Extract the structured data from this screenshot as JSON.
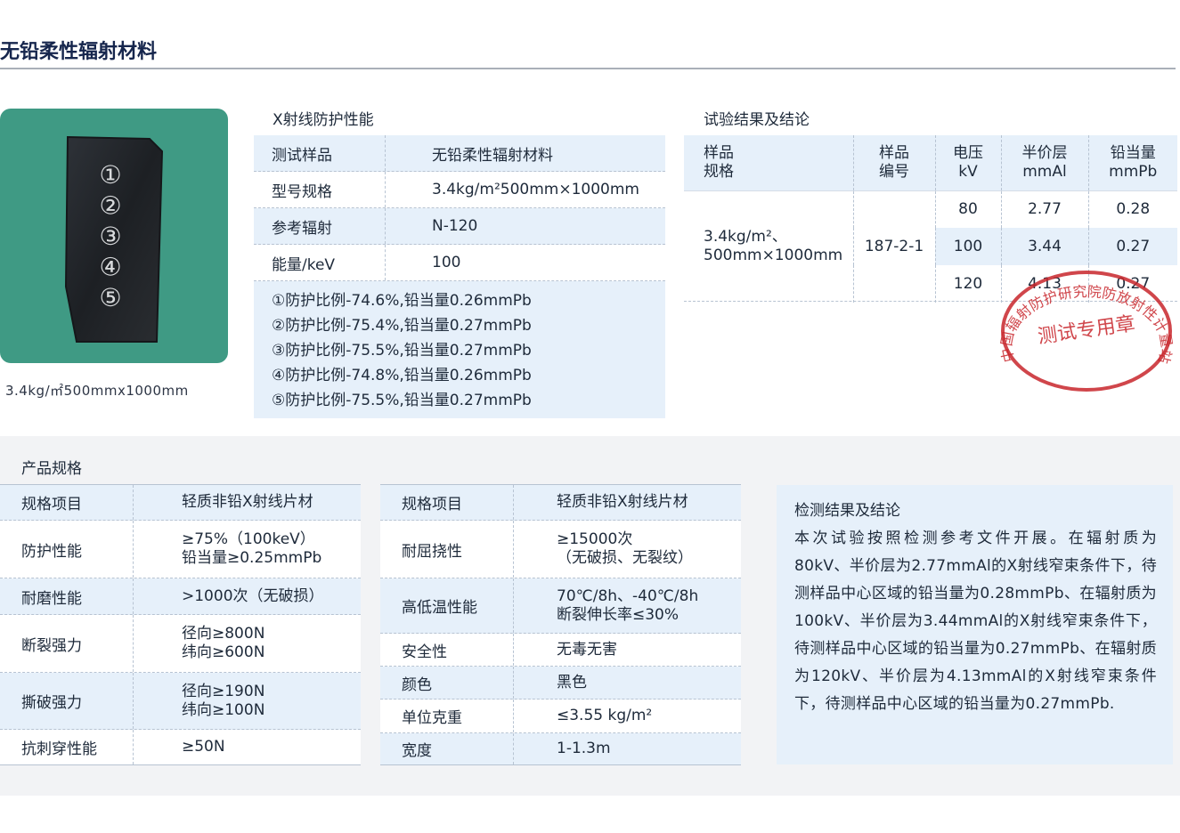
{
  "page_title": "无铅柔性辐射材料",
  "sample": {
    "caption": "3.4kg/㎡500mmx1000mm",
    "markers": [
      "①",
      "②",
      "③",
      "④",
      "⑤"
    ]
  },
  "xray": {
    "heading": "X射线防护性能",
    "rows": [
      {
        "label": "测试样品",
        "value": "无铅柔性辐射材料"
      },
      {
        "label": "型号规格",
        "value": "3.4kg/m²500mm×1000mm"
      },
      {
        "label": "参考辐射",
        "value": "N-120"
      },
      {
        "label": "能量/keV",
        "value": "100"
      }
    ],
    "results": [
      "①防护比例-74.6%,铅当量0.26mmPb",
      "②防护比例-75.4%,铅当量0.27mmPb",
      "③防护比例-75.5%,铅当量0.27mmPb",
      "④防护比例-74.8%,铅当量0.26mmPb",
      "⑤防护比例-75.5%,铅当量0.27mmPb"
    ]
  },
  "test": {
    "heading": "试验结果及结论",
    "headers": [
      {
        "l1": "样品",
        "l2": "规格"
      },
      {
        "l1": "样品",
        "l2": "编号"
      },
      {
        "l1": "电压",
        "l2": "kV"
      },
      {
        "l1": "半价层",
        "l2": "mmAl"
      },
      {
        "l1": "铅当量",
        "l2": "mmPb"
      }
    ],
    "spec_l1": "3.4kg/m²、",
    "spec_l2": "500mm×1000mm",
    "sample_no": "187-2-1",
    "rows": [
      {
        "kv": "80",
        "hvl": "2.77",
        "pb": "0.28"
      },
      {
        "kv": "100",
        "hvl": "3.44",
        "pb": "0.27"
      },
      {
        "kv": "120",
        "hvl": "4.13",
        "pb": "0.27"
      }
    ]
  },
  "stamp": {
    "ring_text": "中国辐射防护研究院防放射性计量站",
    "center_text": "测试专用章",
    "color": "#c8262c"
  },
  "spec": {
    "heading": "产品规格",
    "left": {
      "head": {
        "k": "规格项目",
        "v": [
          "轻质非铅X射线片材"
        ]
      },
      "rows": [
        {
          "k": "防护性能",
          "v": [
            "≥75%（100keV）",
            "铅当量≥0.25mmPb"
          ]
        },
        {
          "k": "耐磨性能",
          "v": [
            ">1000次（无破损）"
          ]
        },
        {
          "k": "断裂强力",
          "v": [
            "径向≥800N",
            "纬向≥600N"
          ]
        },
        {
          "k": "撕破强力",
          "v": [
            "径向≥190N",
            "纬向≥100N"
          ]
        },
        {
          "k": "抗刺穿性能",
          "v": [
            "≥50N"
          ]
        }
      ]
    },
    "right": {
      "head": {
        "k": "规格项目",
        "v": [
          "轻质非铅X射线片材"
        ]
      },
      "rows": [
        {
          "k": "耐屈挠性",
          "v": [
            "≥15000次",
            "（无破损、无裂纹）"
          ]
        },
        {
          "k": "高低温性能",
          "v": [
            "70℃/8h、-40℃/8h",
            "断裂伸长率≤30%"
          ]
        },
        {
          "k": "安全性",
          "v": [
            "无毒无害"
          ]
        },
        {
          "k": "颜色",
          "v": [
            "黑色"
          ]
        },
        {
          "k": "单位克重",
          "v": [
            "≤3.55 kg/m²"
          ]
        },
        {
          "k": "宽度",
          "v": [
            "1-1.3m"
          ]
        }
      ]
    }
  },
  "conclusion": {
    "title": "检测结果及结论",
    "body": "本次试验按照检测参考文件开展。在辐射质为80kV、半价层为2.77mmAl的X射线窄束条件下，待测样品中心区域的铅当量为0.28mmPb、在辐射质为100kV、半价层为3.44mmAl的X射线窄束条件下，待测样品中心区域的铅当量为0.27mmPb、在辐射质为120kV、半价层为4.13mmAl的X射线窄束条件下，待测样品中心区域的铅当量为0.27mmPb."
  }
}
